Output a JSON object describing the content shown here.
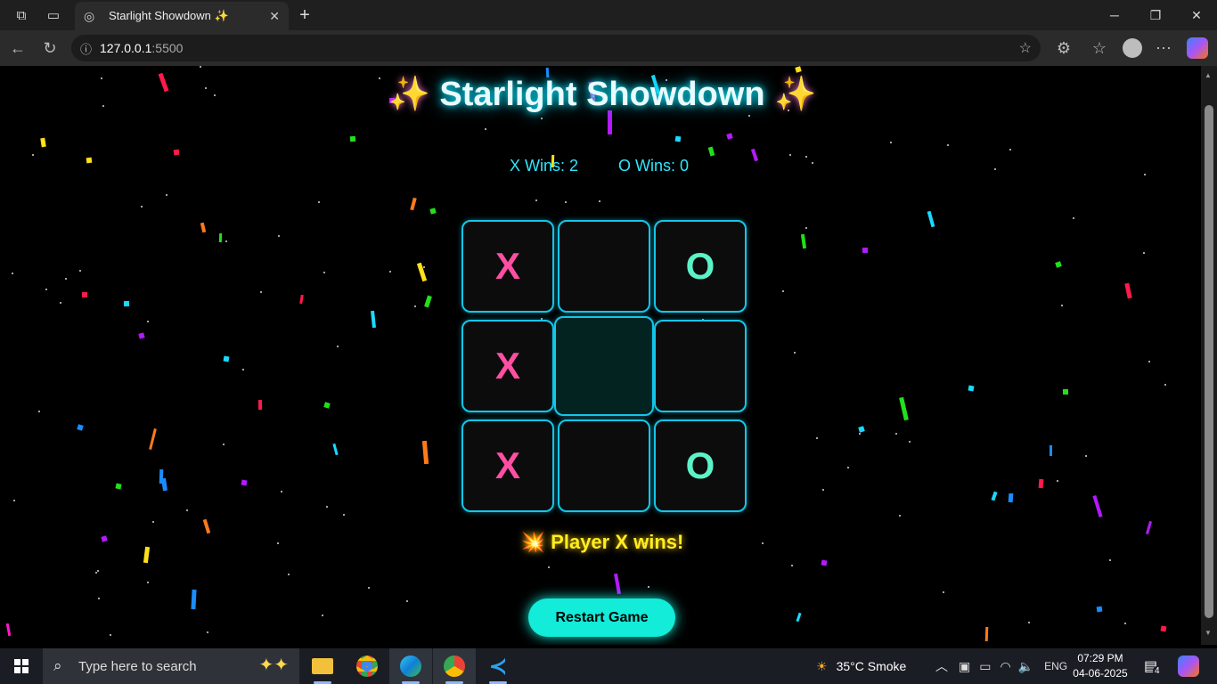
{
  "browser": {
    "tab_title": "Starlight Showdown ✨",
    "url_host": "127.0.0.1",
    "url_port": ":5500"
  },
  "game": {
    "title": "Starlight Showdown",
    "title_spark": "✨",
    "score_x": "X Wins: 2",
    "score_o": "O Wins: 0",
    "board": [
      "X",
      "",
      "O",
      "X",
      "",
      "",
      "X",
      "",
      "O"
    ],
    "status_icon": "💥",
    "status": "Player X wins!",
    "restart_label": "Restart Game"
  },
  "taskbar": {
    "search_placeholder": "Type here to search",
    "weather": "35°C  Smoke",
    "lang": "ENG",
    "time": "07:29 PM",
    "date": "04-06-2025",
    "notif_count": "4"
  },
  "colors": {
    "accent_cyan": "#12ecd9",
    "x_color": "#ff4fa3",
    "o_color": "#5cf2c8",
    "status_yellow": "#ffee22"
  }
}
